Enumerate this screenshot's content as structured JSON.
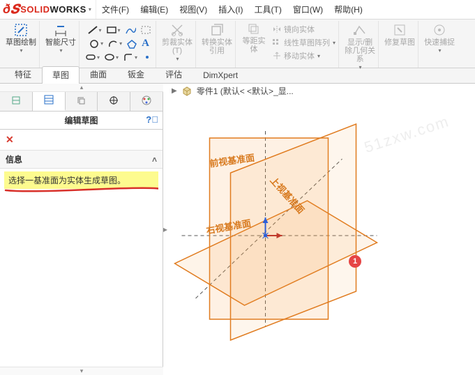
{
  "app": {
    "brand_solid": "SOLID",
    "brand_works": "WORKS"
  },
  "menu": {
    "file": "文件(F)",
    "edit": "编辑(E)",
    "view": "视图(V)",
    "insert": "插入(I)",
    "tools": "工具(T)",
    "window": "窗口(W)",
    "help": "帮助(H)"
  },
  "ribbon": {
    "sketch": "草图绘制",
    "smartdim": "智能尺寸",
    "trim": "剪裁实体(T)",
    "convert": "转换实体引用",
    "offset": "等距实体",
    "mirror": "镜向实体",
    "pattern": "线性草图阵列",
    "move": "移动实体",
    "showhide": "显示/删除几何关系",
    "repair": "修复草图",
    "quick": "快速捕捉"
  },
  "tabs": {
    "feature": "特征",
    "sketch": "草图",
    "surface": "曲面",
    "sheetmetal": "钣金",
    "evaluate": "评估",
    "dimxpert": "DimXpert"
  },
  "panel": {
    "title": "编辑草图",
    "section_info": "信息",
    "hint": "选择一基准面为实体生成草图。"
  },
  "crumb": {
    "part": "零件1  (默认< <默认>_显..."
  },
  "planes": {
    "front": "前视基准面",
    "top": "上视基准面",
    "right": "右视基准面"
  },
  "badge": {
    "num": "1"
  }
}
